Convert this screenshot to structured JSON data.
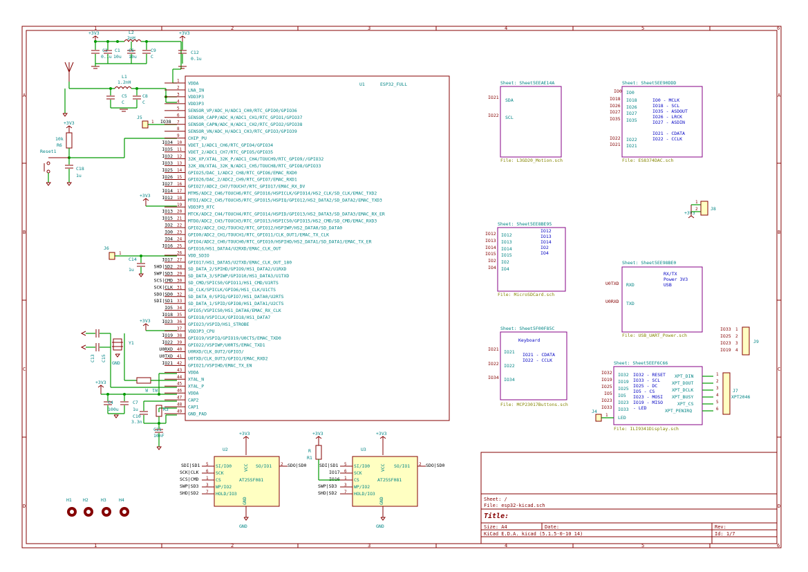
{
  "frame": {
    "cols": [
      "1",
      "2",
      "3",
      "4",
      "5",
      "6"
    ],
    "rows": [
      "A",
      "B",
      "C",
      "D"
    ]
  },
  "power": {
    "p3v3": "+3V3",
    "gnd": "GND"
  },
  "esp32": {
    "ref": "U1",
    "value": "ESP32_FULL",
    "pins": [
      {
        "num": "1",
        "name": "VDDA",
        "net": ""
      },
      {
        "num": "2",
        "name": "LNA_IN",
        "net": ""
      },
      {
        "num": "3",
        "name": "VDD3P3",
        "net": ""
      },
      {
        "num": "4",
        "name": "VDD3P3",
        "net": ""
      },
      {
        "num": "5",
        "name": "SENSOR_VP/ADC_H/ADC1_CH0/RTC_GPIO0/GPIO36",
        "net": ""
      },
      {
        "num": "6",
        "name": "SENSOR_CAPP/ADC_H/ADC1_CH1/RTC_GPIO1/GPIO37",
        "net": ""
      },
      {
        "num": "7",
        "name": "SENSOR_CAPN/ADC_H/ADC1_CH2/RTC_GPIO2/GPIO38",
        "net": "IO38"
      },
      {
        "num": "8",
        "name": "SENSOR_VN/ADC_H/ADC1_CH3/RTC_GPIO3/GPIO39",
        "net": ""
      },
      {
        "num": "9",
        "name": "CHIP_PU",
        "net": ""
      },
      {
        "num": "10",
        "name": "VDET_1/ADC1_CH6/RTC_GPIO4/GPIO34",
        "net": "IO34"
      },
      {
        "num": "11",
        "name": "VDET_2/ADC1_CH7/RTC_GPIO5/GPIO35",
        "net": "IO35"
      },
      {
        "num": "12",
        "name": "32K_XP/XTAL_32K_P/ADC1_CH4/TOUCH9/RTC_GPIO9//GPIO32",
        "net": "IO32"
      },
      {
        "num": "13",
        "name": "32K_XN/XTAL_32K_N/ADC1_CH5/TOUCH8/RTC_GPIO8/GPIO33",
        "net": "IO33"
      },
      {
        "num": "14",
        "name": "GPIO25/DAC_1/ADC2_CH8/RTC_GPIO6/EMAC_RXD0",
        "net": "IO25"
      },
      {
        "num": "15",
        "name": "GPIO26/DAC_2/ADC2_CH9/RTC_GPIO7/EMAC_RXD1",
        "net": "IO26"
      },
      {
        "num": "16",
        "name": "GPIO27/ADC2_CH7/TOUCH7/RTC_GPIO17/EMAC_RX_DV",
        "net": "IO27"
      },
      {
        "num": "17",
        "name": "MTMS/ADC2_CH6/TOUCH6/RTC_GPIO16/HSPICLK/GPIO14/HS2_CLK/SD_CLK/EMAC_TXD2",
        "net": "IO14"
      },
      {
        "num": "18",
        "name": "MTDI/ADC2_CH5/TOUCH5/RTC_GPIO15/HSPIQ/GPIO12/HS2_DATA2/SD_DATA2/EMAC_TXD3",
        "net": "IO12"
      },
      {
        "num": "19",
        "name": "VDD3P3_RTC",
        "net": ""
      },
      {
        "num": "20",
        "name": "MTCK/ADC2_CH4/TOUCH4/RTC_GPIO14/HSPID/GPIO13/HS2_DATA3/SD_DATA3/EMAC_RX_ER",
        "net": "IO13"
      },
      {
        "num": "21",
        "name": "MTDO/ADC2_CH3/TOUCH3/RTC_GPIO13/HSPICS0/GPIO15/HS2_CMD/SD_CMD/EMAC_RXD3",
        "net": "IO15"
      },
      {
        "num": "22",
        "name": "GPIO2/ADC2_CH2/TOUCH2/RTC_GPIO12/HSPIWP/HS2_DATA0/SD_DATA0",
        "net": "IO2"
      },
      {
        "num": "23",
        "name": "GPIO0/ADC2_CH1/TOUCH1/RTC_GPIO11/CLK_OUT1/EMAC_TX_CLK",
        "net": "IO0"
      },
      {
        "num": "24",
        "name": "GPIO4/ADC2_CH0/TOUCH0/RTC_GPIO10/HSPIHD/HS2_DATA1/SD_DATA1/EMAC_TX_ER",
        "net": "IO4"
      },
      {
        "num": "25",
        "name": "GPIO16/HS1_DATA4/U2RXD/EMAC_CLK_OUT",
        "net": "IO16"
      },
      {
        "num": "26",
        "name": "VDD_SDIO",
        "net": ""
      },
      {
        "num": "27",
        "name": "GPIO17/HS1_DATA5/U2TXD/EMAC_CLK_OUT_180",
        "net": "IO17"
      },
      {
        "num": "28",
        "name": "SD_DATA_2/SPIHD/GPIO9/HS1_DATA2/U1RXD",
        "net": "SHD|SD2"
      },
      {
        "num": "29",
        "name": "SD_DATA_3/SPIWP/GPIO10/HS1_DATA3/U1TXD",
        "net": "SWP|SD3"
      },
      {
        "num": "30",
        "name": "SD_CMD/SPICS0/GPIO11/HS1_CMD/U1RTS",
        "net": "SCS|CMD"
      },
      {
        "num": "31",
        "name": "SD_CLK/SPICLK/GPIO6/HS1_CLK/U1CTS",
        "net": "SCK|CLK"
      },
      {
        "num": "32",
        "name": "SD_DATA_0/SPIQ/GPIO7/HS1_DATA0/U2RTS",
        "net": "SDO|SD0"
      },
      {
        "num": "33",
        "name": "SD_DATA_1/SPID/GPIO8/HS1_DATA1/U2CTS",
        "net": "SDI|SD1"
      },
      {
        "num": "34",
        "name": "GPIO5/VSPICS0/HS1_DATA6/EMAC_RX_CLK",
        "net": "IO5"
      },
      {
        "num": "35",
        "name": "GPIO18/VSPICLK/GPIO18/HS1_DATA7",
        "net": "IO18"
      },
      {
        "num": "36",
        "name": "GPIO23/VSPID/HS1_STROBE",
        "net": "IO23"
      },
      {
        "num": "37",
        "name": "VDD3P3_CPU",
        "net": ""
      },
      {
        "num": "38",
        "name": "GPIO19/VSPIQ/GPIO19/U0CTS/EMAC_TXD0",
        "net": "IO19"
      },
      {
        "num": "39",
        "name": "GPIO22/VSPIWP/U0RTS/EMAC_TXD1",
        "net": "IO22"
      },
      {
        "num": "40",
        "name": "U0RXD/CLK_OUT2/GPIO3/",
        "net": "U0RXD"
      },
      {
        "num": "41",
        "name": "U0TXD/CLK_OUT3/GPIO1/EMAC_RXD2",
        "net": "U0TXD"
      },
      {
        "num": "42",
        "name": "GPIO21/VSPIHD/EMAC_TX_EN",
        "net": "IO21"
      },
      {
        "num": "43",
        "name": "VDDA",
        "net": ""
      },
      {
        "num": "44",
        "name": "XTAL_N",
        "net": ""
      },
      {
        "num": "45",
        "name": "XTAL_P",
        "net": ""
      },
      {
        "num": "46",
        "name": "VDDA",
        "net": ""
      },
      {
        "num": "47",
        "name": "CAP2",
        "net": ""
      },
      {
        "num": "48",
        "name": "CAP1",
        "net": ""
      },
      {
        "num": "49",
        "name": "GND_PAD",
        "net": ""
      }
    ]
  },
  "parts": {
    "c3": "C3",
    "c3v": "0.1u",
    "c1": "C1",
    "c1v": "10u",
    "c6": "C6",
    "c6v": "10u",
    "c9": "C9",
    "c9v": "C",
    "c12": "C12",
    "c12v": "0.1u",
    "l2": "L2",
    "l2v": "2nH",
    "l1": "L1",
    "l1v": "1.2nH",
    "c5": "C5",
    "c5v": "C",
    "c8": "C8",
    "c8v": "C",
    "j5": "J5",
    "r6": "R6",
    "r6v": "10k",
    "reset": "Reset1",
    "c18": "C18",
    "c18v": "1u",
    "j6": "J6",
    "c14": "C14",
    "c14v": "1u",
    "y1": "Y1",
    "c13": "C13",
    "c15": "C15",
    "r1x": "R1",
    "c4": "C4",
    "c4v": "100u",
    "c7": "C7",
    "c7v": "1u",
    "c10": "C10",
    "c10v": "3.3n",
    "r3": "R3",
    "c11": "C11",
    "c11v": "10nF",
    "u2": "U2",
    "u3": "U3",
    "flash": "AT25SF081",
    "r1": "R1",
    "rv": "R",
    "h1": "H1",
    "h2": "H2",
    "h3": "H3",
    "h4": "H4",
    "j8": "J8",
    "j9": "J9",
    "j7": "J7",
    "j7v": "XPT2046",
    "j4": "J4",
    "one": "1",
    "two": "2"
  },
  "flash_pins": {
    "si": "SI/IO0",
    "sck": "SCK",
    "cs": "CS",
    "wp": "WP/IO2",
    "hold": "HOLD/IO3",
    "so": "SO/IO1",
    "vcc": "VCC",
    "gnd": "GND"
  },
  "u2_nets": {
    "si": "SDI|SD1",
    "sck": "SCK|CLK",
    "cs": "SCS|CMD",
    "wp": "SWP|SD3",
    "hold": "SHD|SD2",
    "so": "SDO|SD0"
  },
  "u3_nets": {
    "si": "SDI|SD1",
    "sck": "IO17",
    "cs": "IO16",
    "wp": "SWP|SD3",
    "hold": "SHD|SD2",
    "so": "SDO|SD0"
  },
  "sheets": [
    {
      "title": "Sheet: Sheet5EEAE14A",
      "file": "File: L3GD20_Motion.sch",
      "pins": [
        "SDA",
        "SCL"
      ],
      "nets": [
        "IO21",
        "IO22"
      ],
      "notes": []
    },
    {
      "title": "Sheet: Sheet5EE90DDD",
      "file": "File: ES8374DAC.sch",
      "pins": [
        "IO0",
        "IO18",
        "IO26",
        "IO27",
        "IO35",
        "IO22",
        "IO21"
      ],
      "nets": [
        "IO0",
        "IO18",
        "IO26",
        "IO27",
        "IO35",
        "IO22",
        "IO21"
      ],
      "notes": [
        "IO0  - MCLK",
        "IO18  - SCL",
        "IO35  - ASDOUT",
        "IO26  - LRCK",
        "IO27  - ASDIN",
        "",
        "IO21  - CDATA",
        "IO22  - CCLK"
      ]
    },
    {
      "title": "Sheet: Sheet5EE8BE95",
      "file": "File: MicroSDCard.sch",
      "pins": [
        "IO12",
        "IO13",
        "IO14",
        "IO15",
        "IO2",
        "IO4"
      ],
      "nets": [
        "IO12",
        "IO13",
        "IO14",
        "IO15",
        "IO2",
        "IO4"
      ],
      "notes": [
        "IO12",
        "IO13",
        "IO14",
        "IO2",
        "IO4"
      ]
    },
    {
      "title": "Sheet: Sheet5EE98BE0",
      "file": "File: USB_UART_Power.sch",
      "pins": [
        "RXD",
        "TXD"
      ],
      "nets": [
        "U0TXD",
        "U0RXD"
      ],
      "notes": [
        "RX/TX",
        "Power 3V3",
        "USB"
      ]
    },
    {
      "title": "Sheet: Sheet5F00F85C",
      "file": "File: MCP23017Buttons.sch",
      "pins": [
        "IO21",
        "IO22",
        "IO34"
      ],
      "nets": [
        "IO21",
        "IO22",
        "IO34"
      ],
      "notes": [
        "Keyboard",
        "IO21  - CDATA",
        "IO22  - CCLK"
      ]
    },
    {
      "title": "Sheet: Sheet5EEF6C66",
      "file": "File: ILI9341Display.sch",
      "pins": [
        "IO32",
        "IO19",
        "IO25",
        "IO5",
        "IO23",
        "IO33",
        "LED"
      ],
      "nets": [
        "IO32",
        "IO19",
        "IO25",
        "IO5",
        "IO23",
        "IO33"
      ],
      "notes": [
        "IO32  - RESET",
        "IO33  - SCL",
        "IO25  - DC",
        "IO5  - CS",
        "IO23  - MOSI",
        "IO19  - MISO",
        "      - LED"
      ],
      "rpins": [
        "XPT_DIN",
        "XPT_DOUT",
        "XPT_DCLK",
        "XPT_BUSY",
        "XPT_CS",
        "XPT_PENIRQ"
      ]
    }
  ],
  "j9_nets": [
    "IO33",
    "IO25",
    "IO23",
    "IO19"
  ],
  "title_block": {
    "sheet": "Sheet: /",
    "file": "File: esp32-kicad.sch",
    "title": "Title:",
    "size": "Size: A4",
    "date": "Date:",
    "rev": "Rev:",
    "tool": "KiCad E.D.A.  kicad (5.1.5-0-10_14)",
    "id": "Id: 1/7"
  }
}
